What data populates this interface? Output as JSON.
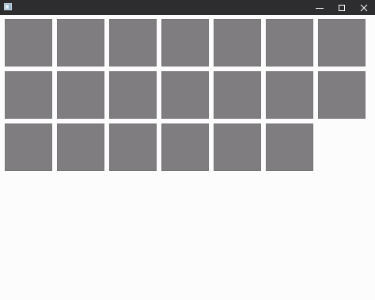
{
  "window": {
    "title": "",
    "icon": "app-window-icon",
    "controls": [
      "minimize-icon",
      "maximize-icon",
      "close-icon"
    ]
  },
  "tiles": {
    "count": 20,
    "columns": 7,
    "color": "#7f7d80"
  },
  "colors": {
    "titlebar": "#2d2d30",
    "background": "#fdfcfd"
  }
}
